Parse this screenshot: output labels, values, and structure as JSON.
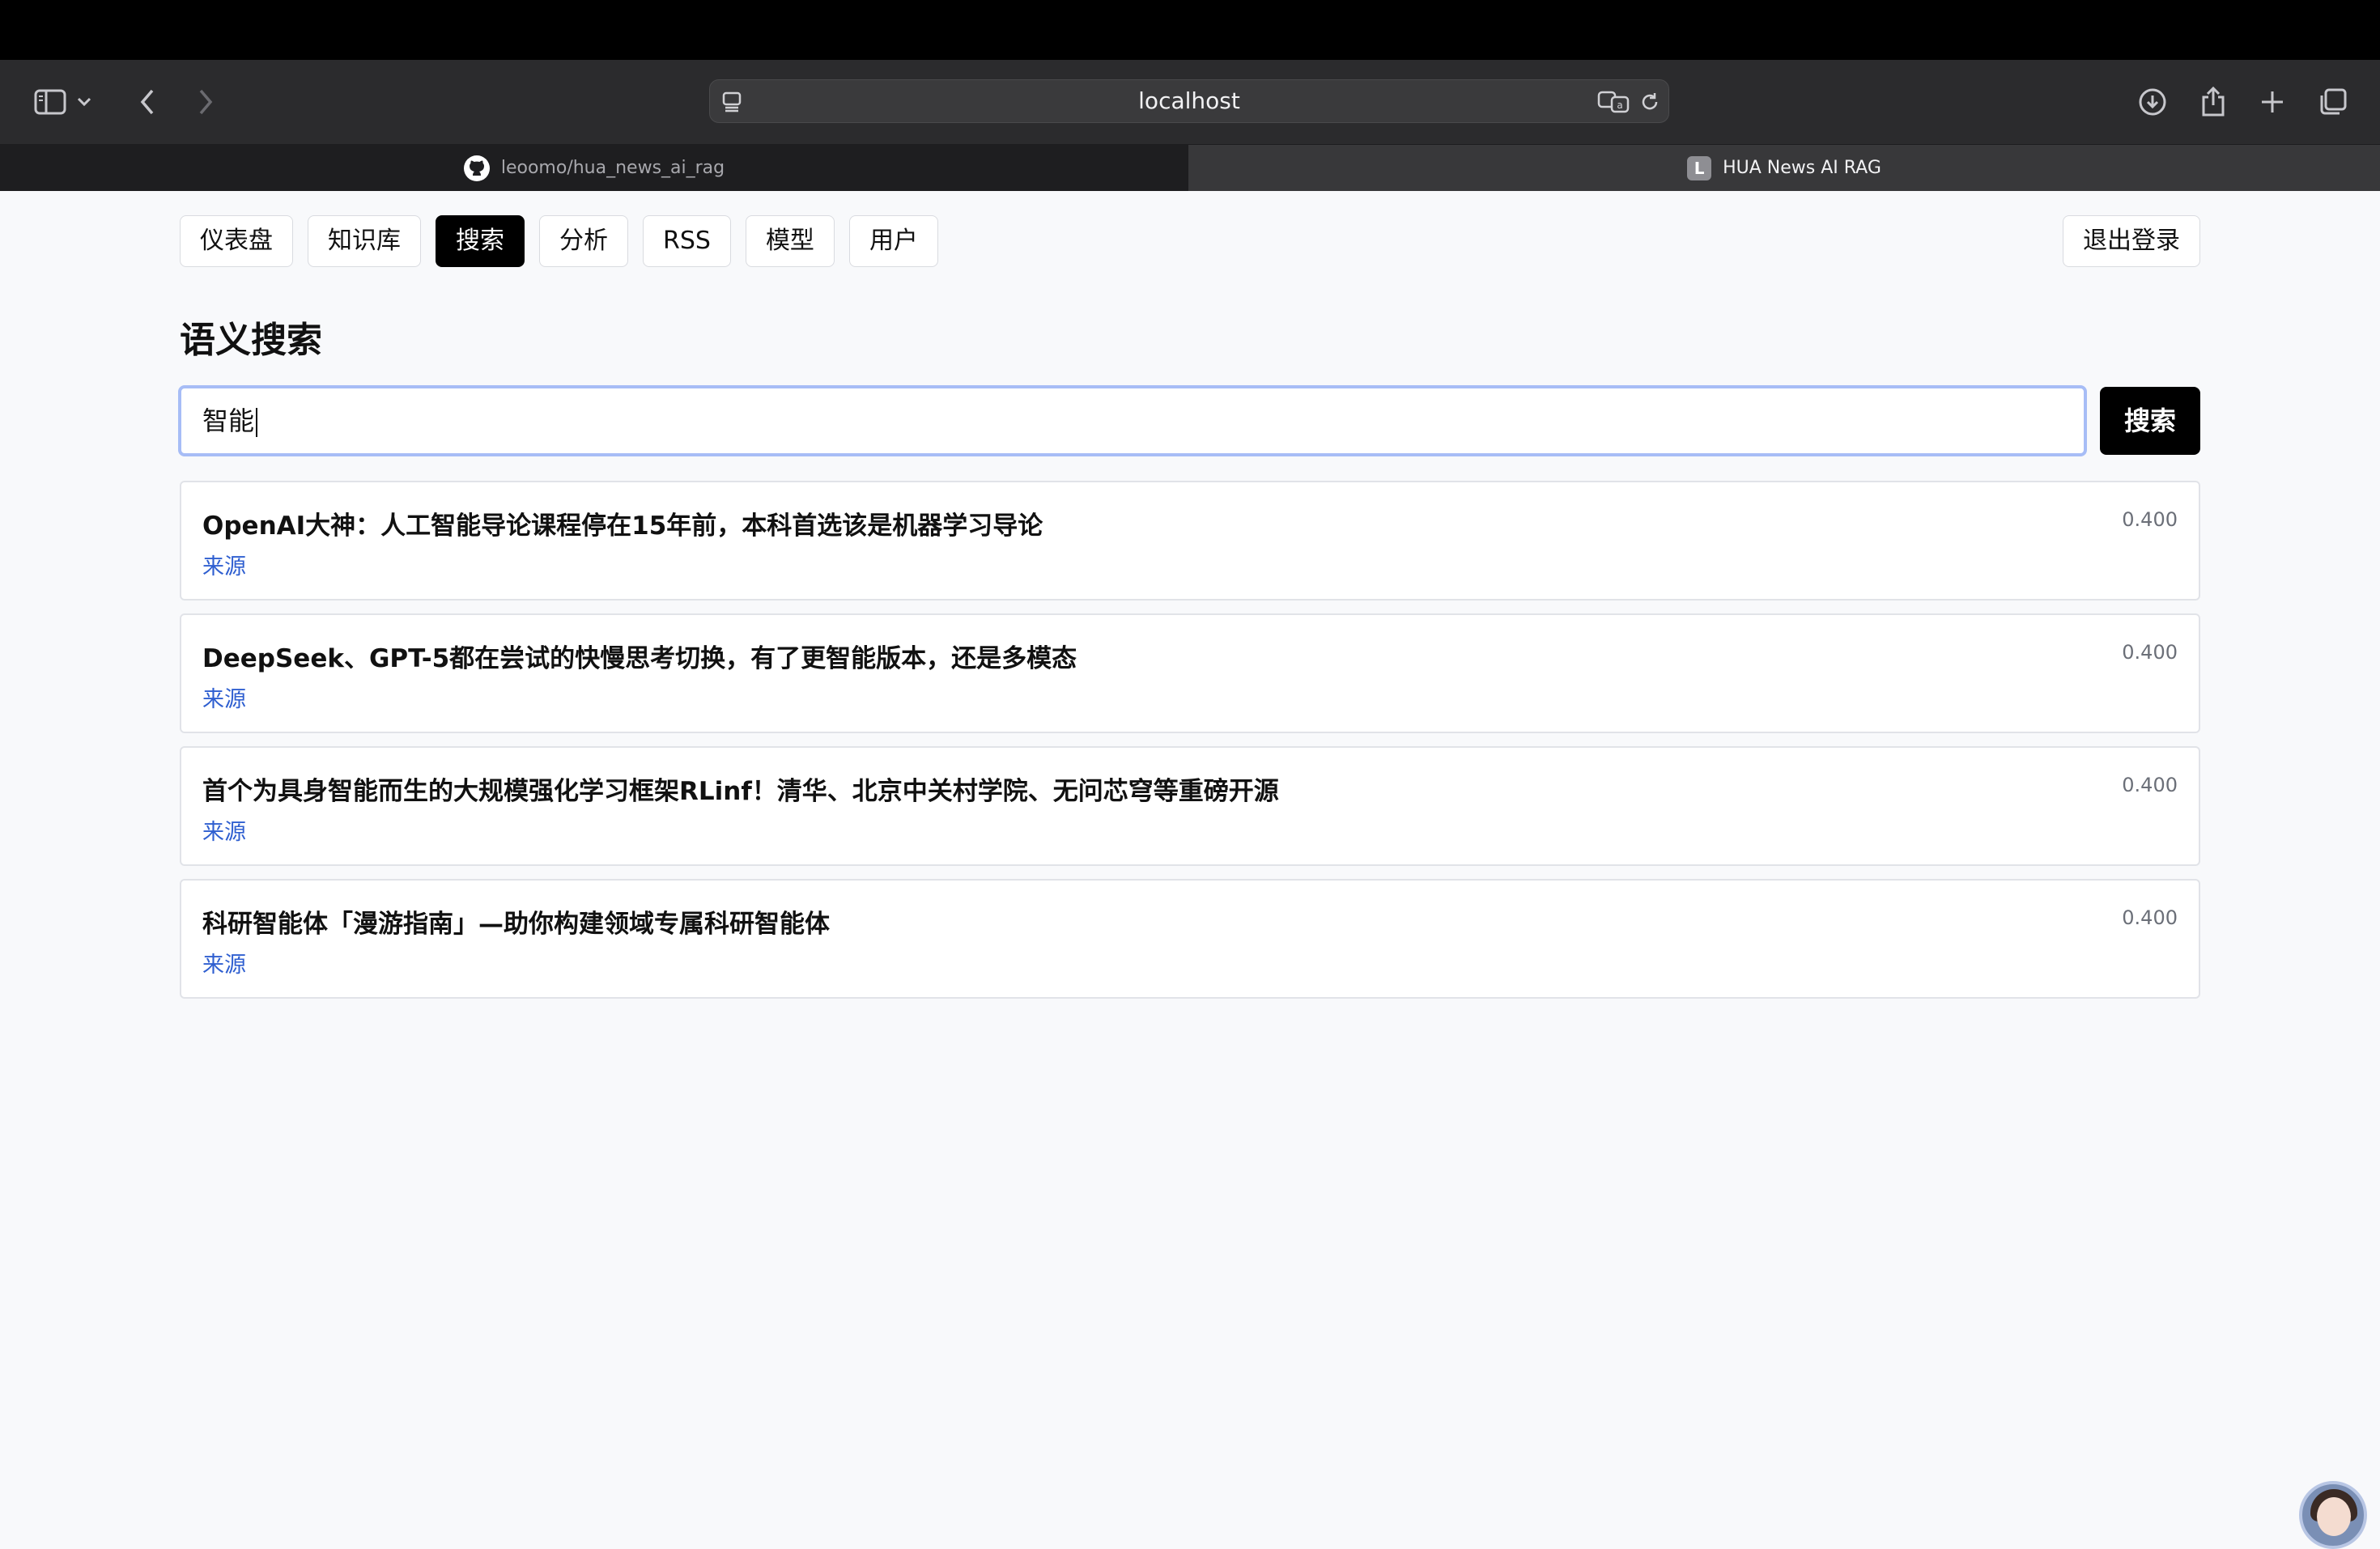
{
  "browser": {
    "url": "localhost",
    "tabs": [
      {
        "label": "leoomo/hua_news_ai_rag",
        "active": false,
        "icon": "github-icon"
      },
      {
        "label": "HUA News AI RAG",
        "active": true,
        "icon_letter": "L"
      }
    ]
  },
  "nav": {
    "items": [
      "仪表盘",
      "知识库",
      "搜索",
      "分析",
      "RSS",
      "模型",
      "用户"
    ],
    "active": "搜索",
    "logout_label": "退出登录"
  },
  "page": {
    "title": "语义搜索"
  },
  "search": {
    "value": "智能",
    "button_label": "搜索"
  },
  "results": [
    {
      "title": "OpenAI大神：人工智能导论课程停在15年前，本科首选该是机器学习导论",
      "source": "来源",
      "score": "0.400"
    },
    {
      "title": "DeepSeek、GPT-5都在尝试的快慢思考切换，有了更智能版本，还是多模态",
      "source": "来源",
      "score": "0.400"
    },
    {
      "title": "首个为具身智能而生的大规模强化学习框架RLinf！清华、北京中关村学院、无问芯穹等重磅开源",
      "source": "来源",
      "score": "0.400"
    },
    {
      "title": "科研智能体「漫游指南」—助你构建领域专属科研智能体",
      "source": "来源",
      "score": "0.400"
    }
  ]
}
